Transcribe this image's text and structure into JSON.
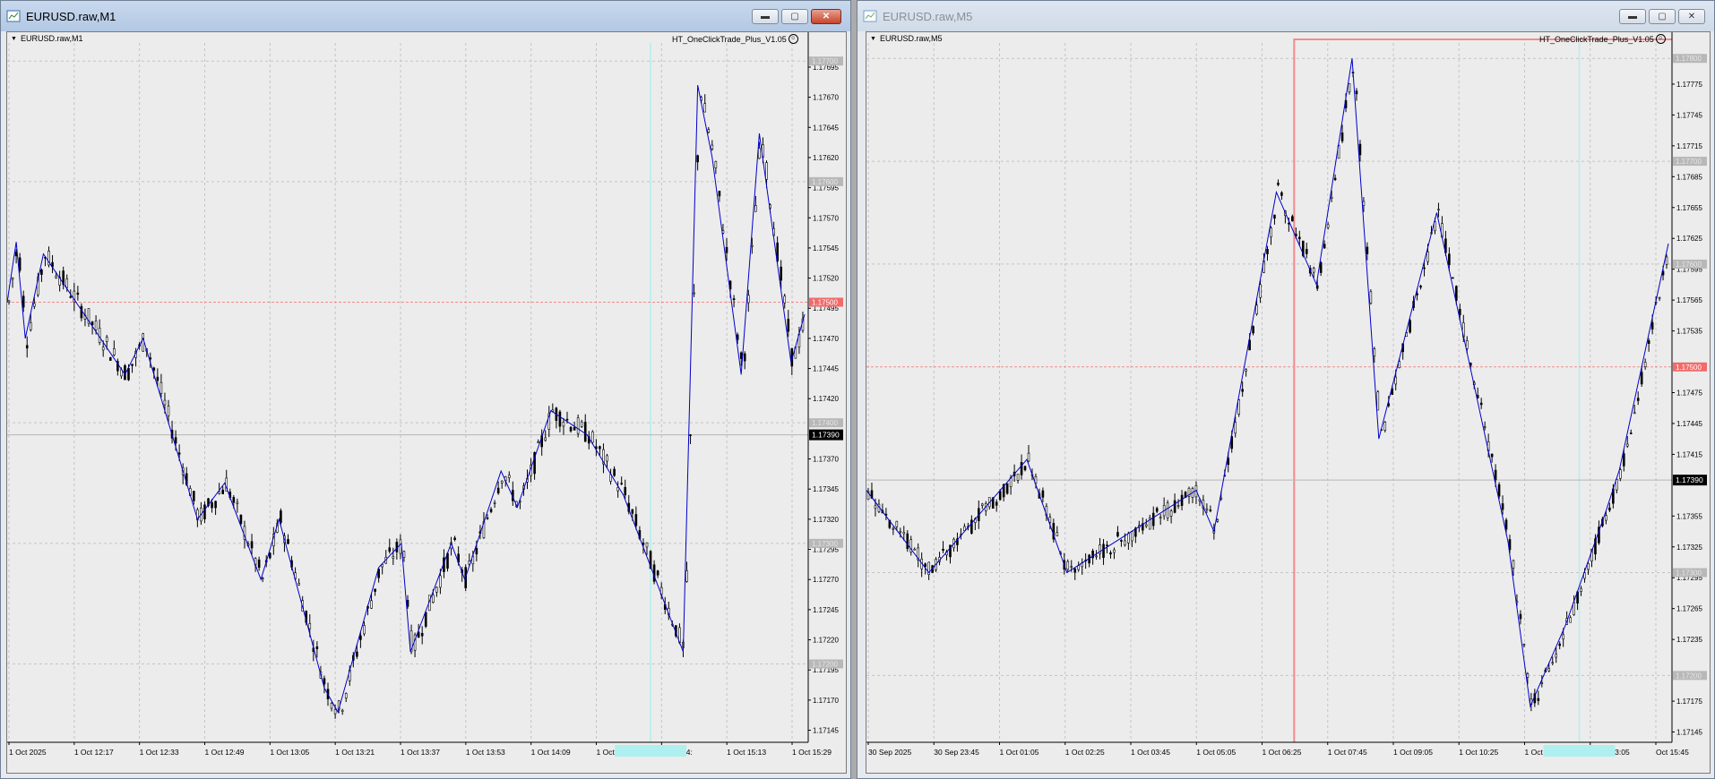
{
  "windows": [
    {
      "title": "EURUSD.raw,M1",
      "chart_label": "EURUSD.raw,M1",
      "ea_label": "HT_OneClickTrade_Plus_V1.05",
      "active": true,
      "controls": {
        "minimize": "minimize",
        "maximize": "maximize",
        "close": "close"
      }
    },
    {
      "title": "EURUSD.raw,M5",
      "chart_label": "EURUSD.raw,M5",
      "ea_label": "HT_OneClickTrade_Plus_V1.05",
      "active": false,
      "controls": {
        "minimize": "minimize",
        "maximize": "maximize",
        "close": "close"
      }
    }
  ],
  "colors": {
    "bull": "#ffffff",
    "bear": "#000000",
    "zigzag": "#0000cc",
    "hline_red": "#f28b8b",
    "vline_cyan": "#aef0ef",
    "current_price_bg": "#000000",
    "red_tag": "#f26a6a",
    "gray_tag": "#b8b8b8"
  },
  "chart_data": [
    {
      "type": "candlestick",
      "symbol": "EURUSD.raw",
      "timeframe": "M1",
      "ylim": [
        1.17135,
        1.17715
      ],
      "y_ticks": [
        "1.17695",
        "1.17670",
        "1.17645",
        "1.17620",
        "1.17595",
        "1.17570",
        "1.17545",
        "1.17520",
        "1.17495",
        "1.17470",
        "1.17445",
        "1.17420",
        "1.17370",
        "1.17345",
        "1.17320",
        "1.17295",
        "1.17270",
        "1.17245",
        "1.17220",
        "1.17195",
        "1.17170",
        "1.17145"
      ],
      "x_labels": [
        "1 Oct 2025",
        "1 Oct 12:17",
        "1 Oct 12:33",
        "1 Oct 12:49",
        "1 Oct 13:05",
        "1 Oct 13:21",
        "1 Oct 13:37",
        "1 Oct 13:53",
        "1 Oct 14:09",
        "1 Oct 14:25",
        "1 Oct 14:",
        "1 Oct 15:13",
        "1 Oct 15:29"
      ],
      "current_price": "1.17390",
      "red_line_price": "1.17500",
      "gray_level_tags": [
        "1.17700",
        "1.17600",
        "1.17400",
        "1.17300",
        "1.17200"
      ],
      "zigzag": [
        [
          0,
          1.175
        ],
        [
          10,
          1.1755
        ],
        [
          20,
          1.1747
        ],
        [
          40,
          1.1754
        ],
        [
          130,
          1.1744
        ],
        [
          150,
          1.1747
        ],
        [
          210,
          1.1732
        ],
        [
          240,
          1.1735
        ],
        [
          280,
          1.1727
        ],
        [
          300,
          1.1732
        ],
        [
          350,
          1.1718
        ],
        [
          365,
          1.1716
        ],
        [
          410,
          1.1728
        ],
        [
          435,
          1.173
        ],
        [
          445,
          1.1721
        ],
        [
          490,
          1.173
        ],
        [
          505,
          1.1727
        ],
        [
          545,
          1.1736
        ],
        [
          563,
          1.1733
        ],
        [
          600,
          1.1741
        ],
        [
          640,
          1.1739
        ],
        [
          680,
          1.1734
        ],
        [
          746,
          1.1721
        ],
        [
          762,
          1.1768
        ],
        [
          778,
          1.1762
        ],
        [
          810,
          1.1744
        ],
        [
          830,
          1.1764
        ],
        [
          865,
          1.1745
        ],
        [
          880,
          1.1749
        ]
      ],
      "cyan_vline_x": 710
    },
    {
      "type": "candlestick",
      "symbol": "EURUSD.raw",
      "timeframe": "M5",
      "ylim": [
        1.17135,
        1.17815
      ],
      "y_ticks": [
        "1.17775",
        "1.17745",
        "1.17715",
        "1.17685",
        "1.17655",
        "1.17625",
        "1.17595",
        "1.17565",
        "1.17535",
        "1.17475",
        "1.17445",
        "1.17415",
        "1.17355",
        "1.17325",
        "1.17295",
        "1.17265",
        "1.17235",
        "1.17175",
        "1.17145"
      ],
      "x_labels": [
        "30 Sep 2025",
        "30 Sep 23:45",
        "1 Oct 01:05",
        "1 Oct 02:25",
        "1 Oct 03:45",
        "1 Oct 05:05",
        "1 Oct 06:25",
        "1 Oct 07:45",
        "1 Oct 09:05",
        "1 Oct 10:25",
        "1 Oct 11:45",
        "1 Oct 13:05",
        "Oct 15:45"
      ],
      "current_price": "1.17390",
      "red_line_price": "1.17500",
      "gray_level_tags": [
        "1.17800",
        "1.17700",
        "1.17600",
        "1.17300",
        "1.17200"
      ],
      "zigzag": [
        [
          0,
          1.1738
        ],
        [
          70,
          1.173
        ],
        [
          180,
          1.1741
        ],
        [
          225,
          1.173
        ],
        [
          370,
          1.1738
        ],
        [
          390,
          1.1734
        ],
        [
          460,
          1.1767
        ],
        [
          505,
          1.1758
        ],
        [
          545,
          1.178
        ],
        [
          575,
          1.1743
        ],
        [
          640,
          1.1765
        ],
        [
          720,
          1.1733
        ],
        [
          745,
          1.1717
        ],
        [
          785,
          1.1725
        ],
        [
          830,
          1.1736
        ],
        [
          845,
          1.174
        ],
        [
          900,
          1.1762
        ]
      ],
      "pink_box_start_x": 480,
      "cyan_vline_x": 800
    }
  ]
}
